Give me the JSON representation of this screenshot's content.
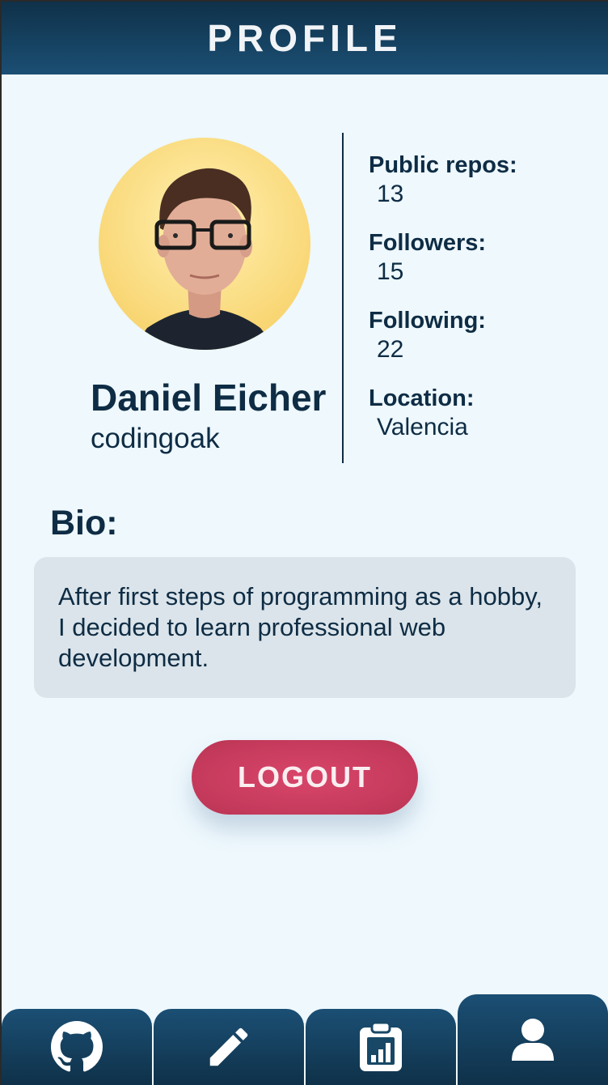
{
  "header": {
    "title": "PROFILE"
  },
  "profile": {
    "name": "Daniel Eicher",
    "username": "codingoak"
  },
  "stats": [
    {
      "label": "Public repos:",
      "value": "13"
    },
    {
      "label": "Followers:",
      "value": "15"
    },
    {
      "label": "Following:",
      "value": "22"
    },
    {
      "label": "Location:",
      "value": "Valencia"
    }
  ],
  "bio": {
    "heading": "Bio:",
    "text": "After first steps of programming as a hobby, I decided to learn professional web development."
  },
  "actions": {
    "logout_label": "LOGOUT"
  },
  "nav": {
    "tabs": [
      {
        "icon": "github-icon",
        "active": false
      },
      {
        "icon": "pencil-icon",
        "active": false
      },
      {
        "icon": "clipboard-chart-icon",
        "active": false
      },
      {
        "icon": "user-icon",
        "active": true
      }
    ]
  },
  "colors": {
    "header": "#0f3149",
    "text": "#0e2c44",
    "background": "#eef8fd",
    "bio_box": "#dbe4ea",
    "logout": "#c53a5c"
  }
}
